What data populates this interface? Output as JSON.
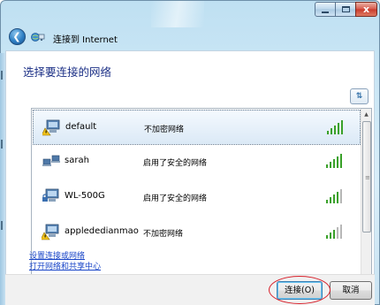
{
  "window": {
    "title": "连接到 Internet",
    "controls": {
      "minimize": "minimize",
      "maximize": "maximize",
      "close": "x"
    },
    "colors": {
      "chrome": "#bfe0f2",
      "close_button": "#c83a2c",
      "heading": "#1e3287",
      "link": "#1a46c8",
      "highlight_ring": "#d8202a",
      "signal_on": "#3aa12a"
    }
  },
  "nav": {
    "back_icon": "back-arrow-icon",
    "app_icon": "network-globe-icon"
  },
  "main": {
    "heading": "选择要连接的网络",
    "refresh_icon": "refresh-icon",
    "networks": [
      {
        "name": "default",
        "security": "不加密网络",
        "selected": true,
        "icon": "unsecured-network-icon",
        "signal_bars": 5
      },
      {
        "name": "sarah",
        "security": "启用了安全的网络",
        "selected": false,
        "icon": "adhoc-computers-icon",
        "signal_bars": 5
      },
      {
        "name": "WL-500G",
        "security": "启用了安全的网络",
        "selected": false,
        "icon": "secured-network-icon",
        "signal_bars": 4
      },
      {
        "name": "applededianmao",
        "security": "不加密网络",
        "selected": false,
        "icon": "unsecured-network-icon",
        "signal_bars": 3
      }
    ],
    "links": [
      {
        "label": "设置连接或网络"
      },
      {
        "label": "打开网络和共享中心"
      }
    ]
  },
  "footer": {
    "connect_label": "连接(O)",
    "cancel_label": "取消"
  }
}
